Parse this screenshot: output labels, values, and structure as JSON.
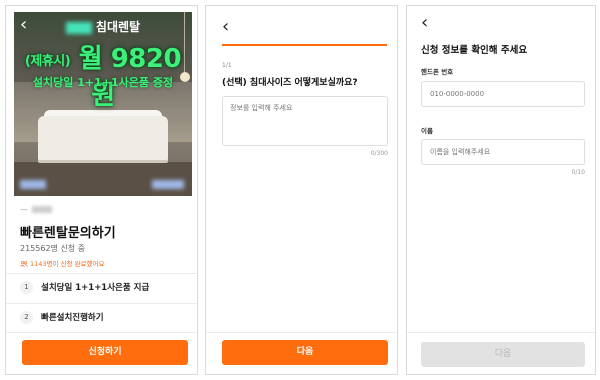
{
  "panel1": {
    "back_icon": "chevron-left-icon",
    "banner": {
      "line1": "침대렌탈",
      "prefix": "(제휴시)",
      "price": "월 9820원",
      "line3": "설치당일 1+1+1사은품 증정"
    },
    "brand_dash": "—",
    "title": "빠른렌탈문의하기",
    "applicant_count": "215562명 신청 중",
    "recent_text": "1143명이 신청 완료했어요",
    "recent_icon": "people-icon",
    "steps": [
      {
        "num": "1",
        "label": "설치당일 1+1+1사은품 지급"
      },
      {
        "num": "2",
        "label": "빠른설치진행하기"
      }
    ],
    "cta": "신청하기",
    "accent": "#ff6d0f"
  },
  "panel2": {
    "back_icon": "chevron-left-icon",
    "progress": 1.0,
    "step": "1/1",
    "question": "(선택) 침대사이즈 어떻게보실까요?",
    "placeholder": "정보를 입력해 주세요",
    "counter": "0/300",
    "cta": "다음"
  },
  "panel3": {
    "back_icon": "chevron-left-icon",
    "title": "신청 정보를 확인해 주세요",
    "phone_label": "핸드폰 번호",
    "phone_placeholder": "010-0000-0000",
    "name_label": "이름",
    "name_placeholder": "이름을 입력해주세요",
    "name_counter": "0/10",
    "cta": "다음"
  }
}
